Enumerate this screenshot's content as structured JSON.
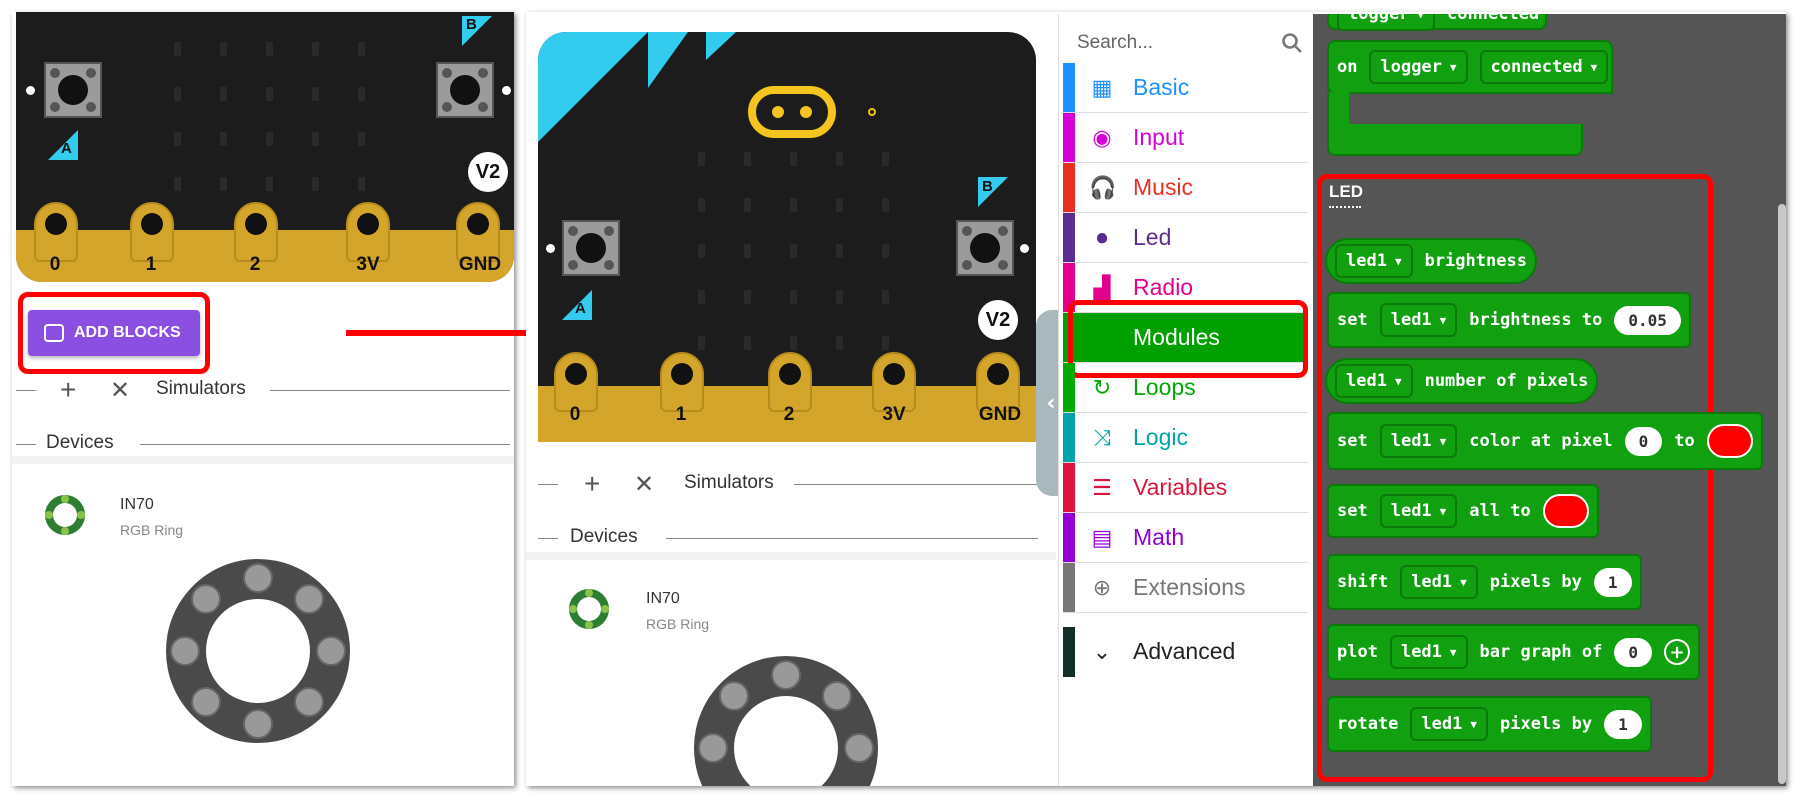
{
  "left_panel": {
    "add_blocks_label": "ADD BLOCKS",
    "pin_labels": [
      "0",
      "1",
      "2",
      "3V",
      "GND"
    ],
    "button_a": "A",
    "button_b": "B",
    "version_badge": "V2",
    "simulators_label": "Simulators",
    "devices_label": "Devices",
    "device": {
      "name": "IN70",
      "type": "RGB Ring"
    }
  },
  "middle_panel": {
    "pin_labels": [
      "0",
      "1",
      "2",
      "3V",
      "GND"
    ],
    "button_a": "A",
    "button_b": "B",
    "version_badge": "V2",
    "simulators_label": "Simulators",
    "devices_label": "Devices",
    "device": {
      "name": "IN70",
      "type": "RGB Ring"
    }
  },
  "toolbox": {
    "search_placeholder": "Search...",
    "categories": [
      {
        "label": "Basic",
        "color": "#1e90ff",
        "icon": "grid-icon"
      },
      {
        "label": "Input",
        "color": "#d400d4",
        "icon": "radio-dot-icon"
      },
      {
        "label": "Music",
        "color": "#e63022",
        "icon": "headphones-icon"
      },
      {
        "label": "Led",
        "color": "#5c2d91",
        "icon": "toggle-icon"
      },
      {
        "label": "Radio",
        "color": "#e3008c",
        "icon": "signal-bars-icon"
      },
      {
        "label": "Modules",
        "color": "#00a000",
        "icon": "none"
      },
      {
        "label": "Loops",
        "color": "#00aa00",
        "icon": "loop-arrow-icon"
      },
      {
        "label": "Logic",
        "color": "#00a4a6",
        "icon": "shuffle-icon"
      },
      {
        "label": "Variables",
        "color": "#dc143c",
        "icon": "list-lines-icon"
      },
      {
        "label": "Math",
        "color": "#9400d3",
        "icon": "calculator-icon"
      },
      {
        "label": "Extensions",
        "color": "#777777",
        "icon": "plus-circle-icon"
      }
    ],
    "advanced_label": "Advanced"
  },
  "workspace": {
    "top_block": {
      "prefix": "on",
      "dropdown1": "logger",
      "dropdown2": "connected"
    },
    "partial_top": {
      "dropdown1": "logger",
      "text": "connected"
    },
    "section_label": "LED",
    "blocks": [
      {
        "parts": [
          "led1",
          "brightness"
        ]
      },
      {
        "parts": [
          "set",
          "led1",
          "brightness to",
          "0.05"
        ]
      },
      {
        "parts": [
          "led1",
          "number of pixels"
        ]
      },
      {
        "parts": [
          "set",
          "led1",
          "color at pixel",
          "0",
          "to"
        ]
      },
      {
        "parts": [
          "set",
          "led1",
          "all to"
        ]
      },
      {
        "parts": [
          "shift",
          "led1",
          "pixels by",
          "1"
        ]
      },
      {
        "parts": [
          "plot",
          "led1",
          "bar graph of",
          "0"
        ]
      },
      {
        "parts": [
          "rotate",
          "led1",
          "pixels by",
          "1"
        ]
      }
    ]
  },
  "colors": {
    "highlight_red": "#ff0000",
    "block_green": "#10a010",
    "add_blocks_purple": "#8a4fe0",
    "triangle_cyan": "#33ccee"
  }
}
